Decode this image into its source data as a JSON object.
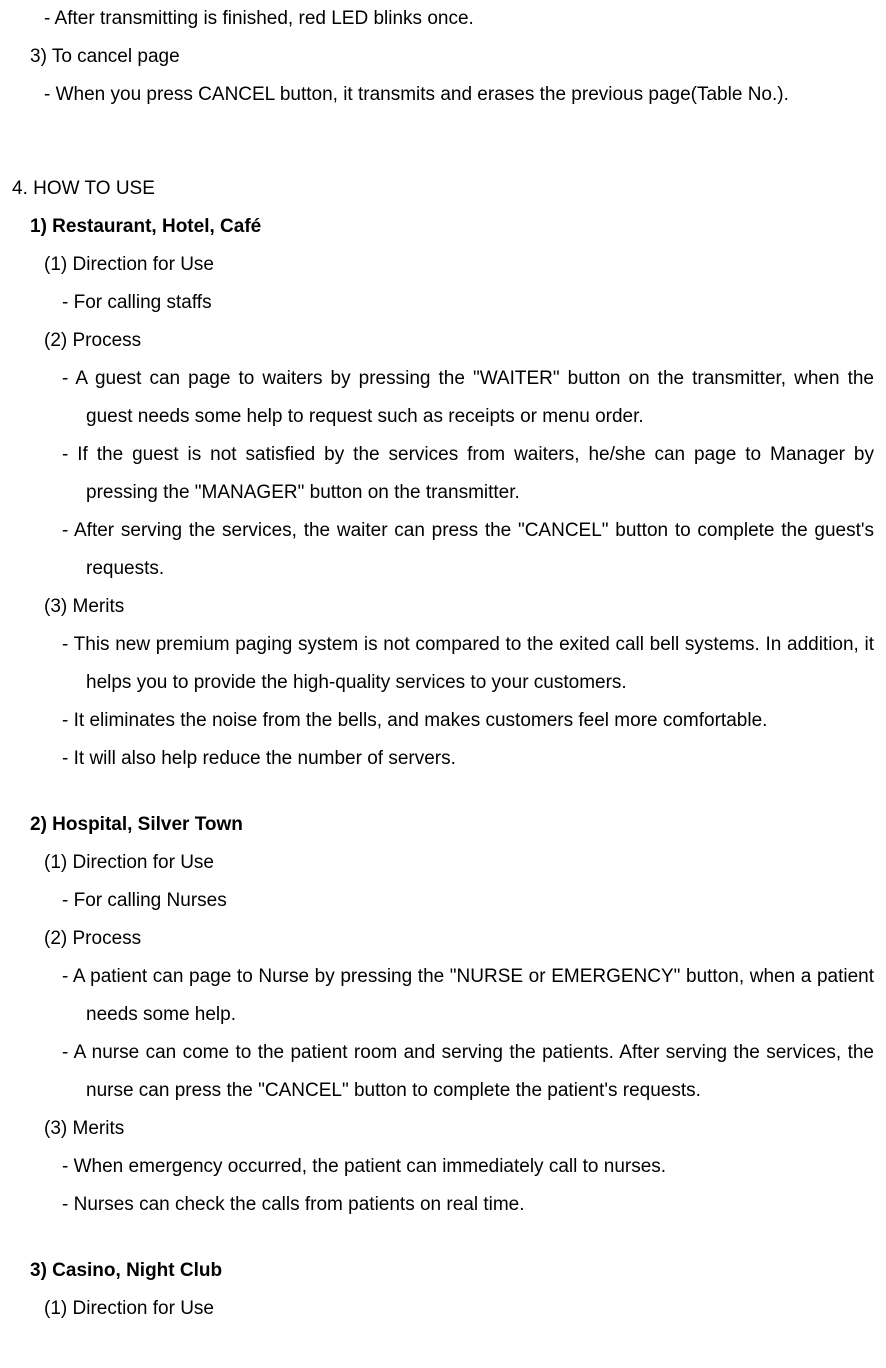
{
  "top": {
    "line1": "- After transmitting is finished, red LED blinks once.",
    "line2": "3) To cancel page",
    "line3": "- When you press CANCEL button, it transmits and erases the previous page(Table No.)."
  },
  "section4": {
    "heading": "4. HOW TO USE",
    "use1": {
      "title": "1) Restaurant, Hotel, Café",
      "direction_label": "(1) Direction for Use",
      "direction_item": "- For calling staffs",
      "process_label": "(2) Process",
      "process_items": [
        "- A guest can page to waiters by pressing the \"WAITER\" button on the transmitter, when the guest needs some help to request such as receipts or menu order.",
        "- If the guest is not satisfied by the services from waiters, he/she can page to Manager by pressing the \"MANAGER\" button on the transmitter.",
        "- After serving the services, the waiter can press the \"CANCEL\" button to complete the guest's requests."
      ],
      "merits_label": "(3) Merits",
      "merits_items": [
        "- This new premium paging system is not compared to the exited call bell systems. In addition, it helps you to provide the high-quality services to your customers.",
        "- It eliminates the noise from the bells, and makes customers feel more comfortable.",
        "- It will also help reduce the number of servers."
      ]
    },
    "use2": {
      "title": "2) Hospital, Silver Town",
      "direction_label": "(1) Direction for Use",
      "direction_item": "- For calling Nurses",
      "process_label": "(2) Process",
      "process_items": [
        "- A patient can page to Nurse by pressing the \"NURSE or EMERGENCY\" button, when a patient needs some help.",
        "- A nurse can come to the patient room and serving the patients. After serving the services, the nurse can press the \"CANCEL\" button to complete the patient's requests."
      ],
      "merits_label": "(3) Merits",
      "merits_items": [
        "- When emergency occurred, the patient can immediately call to nurses.",
        "- Nurses can check the calls from patients on real time."
      ]
    },
    "use3": {
      "title": "3) Casino, Night Club",
      "direction_label": "(1) Direction for Use"
    }
  }
}
